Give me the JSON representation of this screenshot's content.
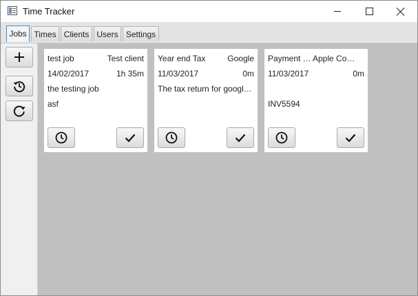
{
  "window": {
    "title": "Time Tracker"
  },
  "tabs": [
    "Jobs",
    "Times",
    "Clients",
    "Users",
    "Settings"
  ],
  "active_tab": "Jobs",
  "toolbar": {
    "icons": [
      "plus-icon",
      "history-icon",
      "refresh-icon"
    ]
  },
  "jobs": [
    {
      "title": "test job",
      "client": "Test client",
      "date": "14/02/2017",
      "duration": "1h 35m",
      "description": "the testing job",
      "reference": "asf"
    },
    {
      "title": "Year end Tax",
      "client": "Google",
      "date": "11/03/2017",
      "duration": "0m",
      "description": "The tax return for google ...",
      "reference": ""
    },
    {
      "title": "Payment re...",
      "client": "Apple Com...",
      "date": "11/03/2017",
      "duration": "0m",
      "description": "",
      "reference": "INV5594"
    }
  ],
  "colors": {
    "content_bg": "#c0c0c0",
    "card_bg": "#ffffff",
    "active_tab_border": "#3c8fd6"
  }
}
